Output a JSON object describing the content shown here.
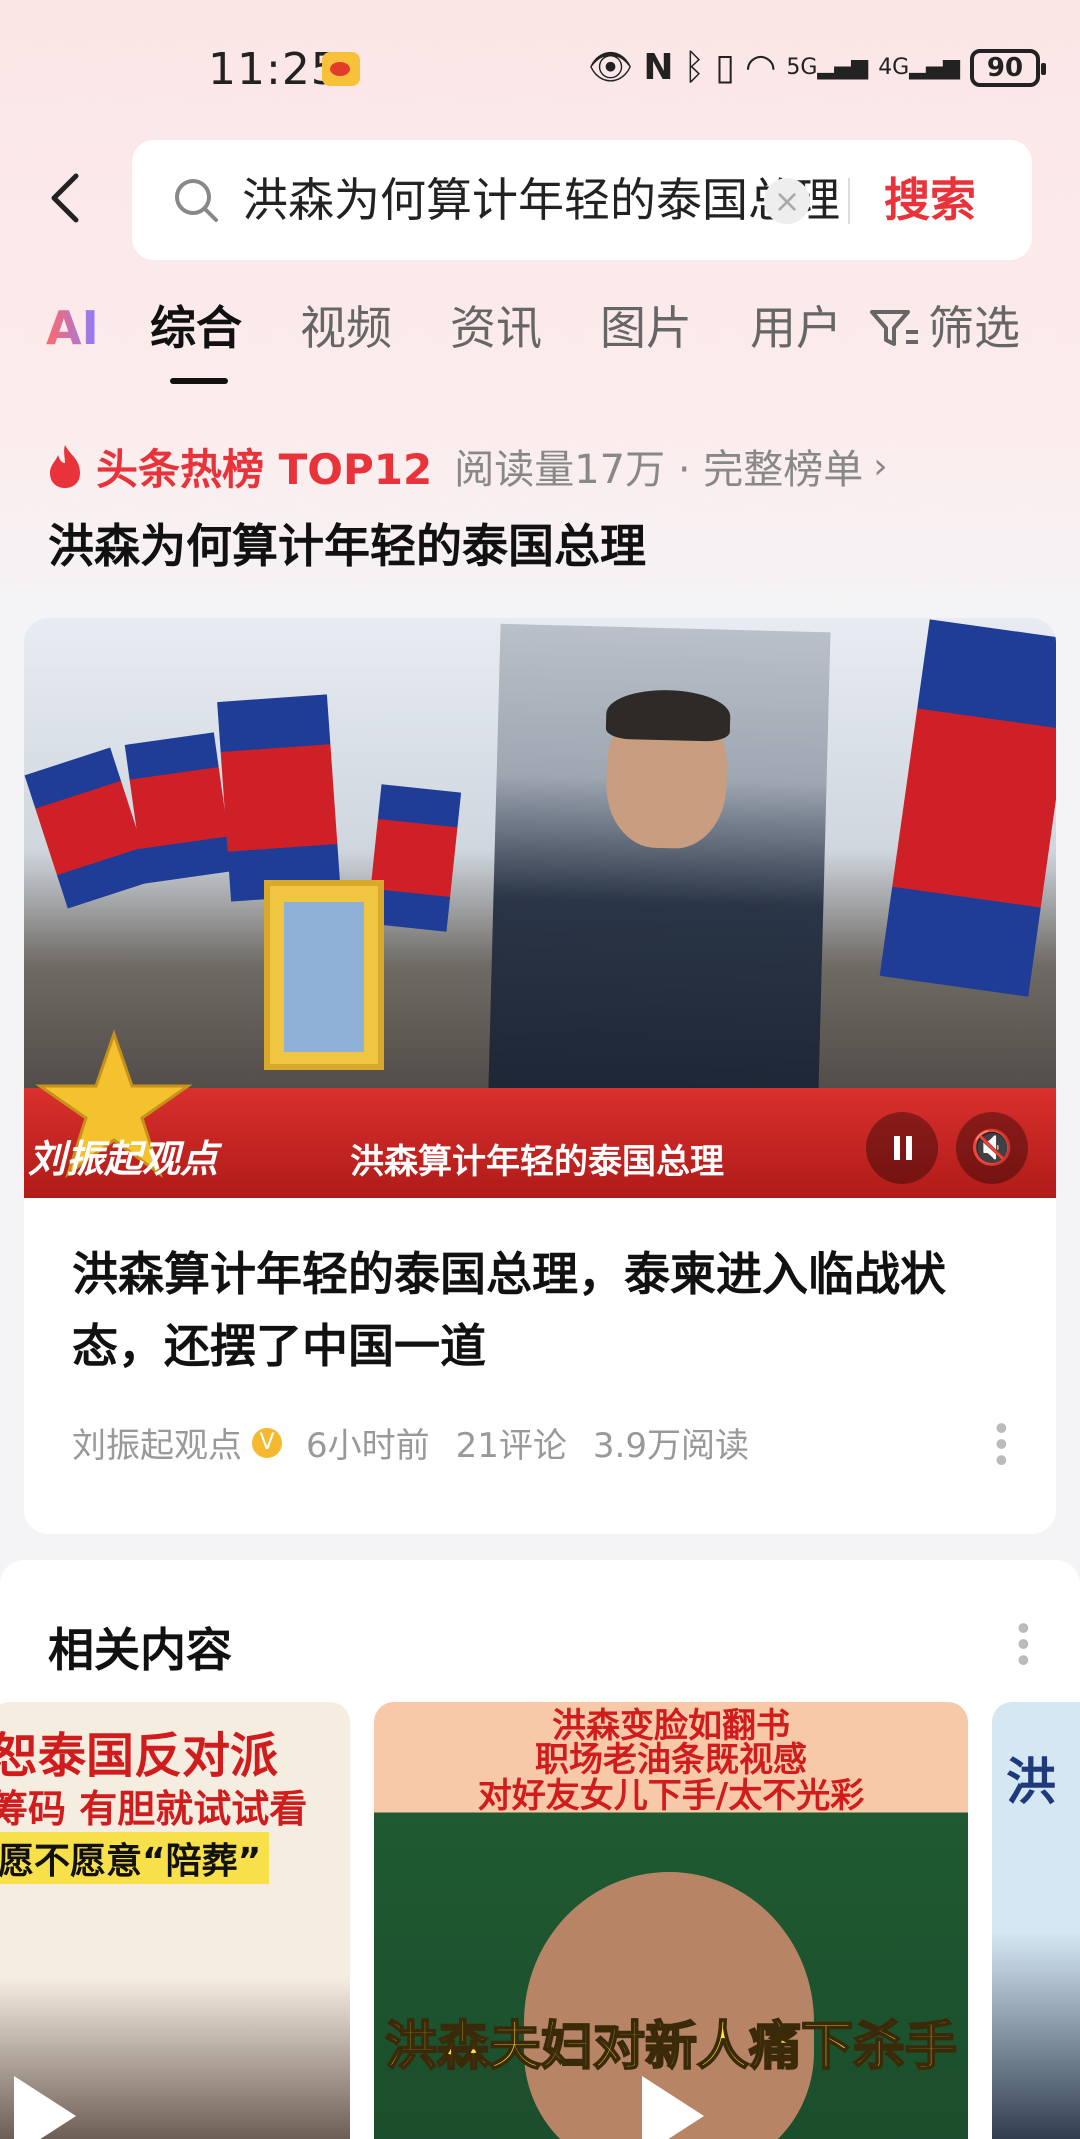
{
  "status_bar": {
    "time": "11:25",
    "battery": "90",
    "icons": [
      "weibo-icon",
      "eye-icon",
      "nfc-icon",
      "bluetooth-icon",
      "vibrate-icon",
      "wifi-icon",
      "signal-5g-icon",
      "signal-4g-icon",
      "battery-icon"
    ],
    "net_5g": "5G",
    "net_4g": "4G"
  },
  "search": {
    "query": "洪森为何算计年轻的泰国总理",
    "submit_label": "搜索"
  },
  "tabs": [
    {
      "label": "AI"
    },
    {
      "label": "综合",
      "active": true
    },
    {
      "label": "视频"
    },
    {
      "label": "资讯"
    },
    {
      "label": "图片"
    },
    {
      "label": "用户"
    }
  ],
  "filter_label": "筛选",
  "hot": {
    "label": "头条热榜 TOP12",
    "meta": "阅读量17万 · 完整榜单",
    "title": "洪森为何算计年轻的泰国总理"
  },
  "article": {
    "video_channel": "刘振起观点",
    "video_caption": "洪森算计年轻的泰国总理",
    "title": "洪森算计年轻的泰国总理，泰柬进入临战状态，还摆了中国一道",
    "author": "刘振起观点",
    "time": "6小时前",
    "comments": "21评论",
    "reads": "3.9万阅读"
  },
  "related": {
    "title": "相关内容",
    "items": [
      {
        "lines": [
          "恕泰国反对派",
          "筹码 有胆就试试看",
          "愿不愿意“陪葬”"
        ]
      },
      {
        "lines": [
          "洪森变脸如翻书",
          "职场老油条既视感",
          "对好友女儿下手/太不光彩"
        ],
        "caption": "洪森夫妇对新人痛下杀手"
      },
      {
        "lines": [
          "洪"
        ]
      }
    ]
  },
  "colors": {
    "accent_red": "#e8333a",
    "verified_gold": "#f5b82e"
  }
}
